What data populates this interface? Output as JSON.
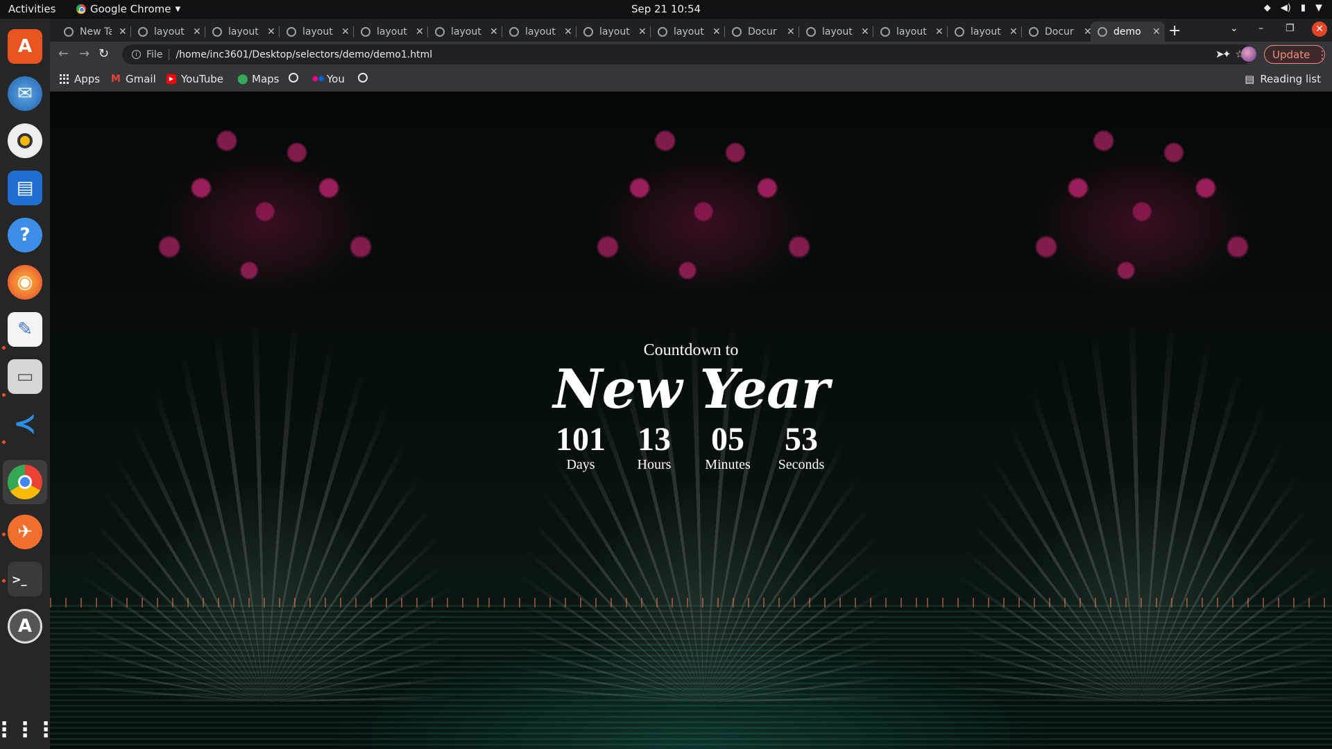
{
  "system_bar": {
    "activities": "Activities",
    "app_name": "Google Chrome",
    "clock": "Sep 21  10:54"
  },
  "dock": {
    "apps": [
      "app-center",
      "thunderbird",
      "rhythmbox",
      "writer",
      "help",
      "firefox",
      "text-editor",
      "files",
      "vscode",
      "chrome",
      "postman",
      "terminal",
      "software-updater",
      "show-apps"
    ]
  },
  "tabs": [
    {
      "title": "New Tab"
    },
    {
      "title": "layout"
    },
    {
      "title": "layout"
    },
    {
      "title": "layout"
    },
    {
      "title": "layout"
    },
    {
      "title": "layout"
    },
    {
      "title": "layout"
    },
    {
      "title": "layout"
    },
    {
      "title": "layout"
    },
    {
      "title": "Docur"
    },
    {
      "title": "layout"
    },
    {
      "title": "layout"
    },
    {
      "title": "layout"
    },
    {
      "title": "Docur"
    },
    {
      "title": "demo"
    }
  ],
  "toolbar": {
    "scheme": "File",
    "url": "/home/inc3601/Desktop/selectors/demo/demo1.html",
    "update_label": "Update"
  },
  "bookmarks": {
    "apps": "Apps",
    "gmail": "Gmail",
    "youtube": "YouTube",
    "maps": "Maps",
    "you": "You",
    "reading_list": "Reading list"
  },
  "countdown": {
    "pre_title": "Countdown to",
    "title": "New Year",
    "units": [
      {
        "value": "101",
        "label": "Days"
      },
      {
        "value": "13",
        "label": "Hours"
      },
      {
        "value": "05",
        "label": "Minutes"
      },
      {
        "value": "53",
        "label": "Seconds"
      }
    ]
  }
}
